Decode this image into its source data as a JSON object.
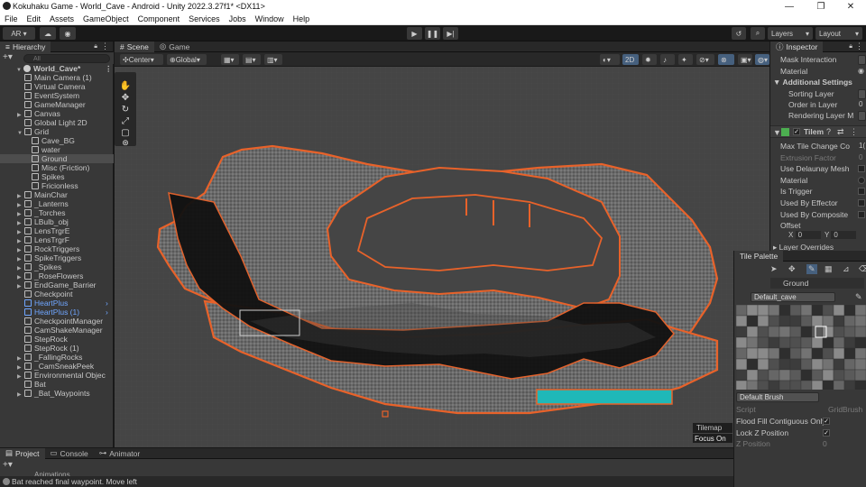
{
  "window": {
    "title": "Kokuhaku Game - World_Cave - Android - Unity 2022.3.27f1* <DX11>",
    "controls": [
      "—",
      "❐",
      "✕"
    ]
  },
  "menu": [
    "File",
    "Edit",
    "Assets",
    "GameObject",
    "Component",
    "Services",
    "Jobs",
    "Window",
    "Help"
  ],
  "toolbar": {
    "account": "AR ▾",
    "layers": "Layers",
    "layout": "Layout"
  },
  "hierarchy": {
    "tab": "Hierarchy",
    "search_placeholder": "All",
    "scene": "World_Cave*",
    "items": [
      {
        "label": "Main Camera (1)",
        "indent": 1
      },
      {
        "label": "Virtual Camera",
        "indent": 1
      },
      {
        "label": "EventSystem",
        "indent": 1
      },
      {
        "label": "GameManager",
        "indent": 1
      },
      {
        "label": "Canvas",
        "indent": 1,
        "arrow": true
      },
      {
        "label": "Global Light 2D",
        "indent": 1
      },
      {
        "label": "Grid",
        "indent": 1,
        "arrow": true,
        "open": true
      },
      {
        "label": "Cave_BG",
        "indent": 2
      },
      {
        "label": "water",
        "indent": 2
      },
      {
        "label": "Ground",
        "indent": 2,
        "selected": true
      },
      {
        "label": "Misc (Friction)",
        "indent": 2
      },
      {
        "label": "Spikes",
        "indent": 2
      },
      {
        "label": "Fricionless",
        "indent": 2
      },
      {
        "label": "MainChar",
        "indent": 1,
        "arrow": true
      },
      {
        "label": "_Lanterns",
        "indent": 1,
        "arrow": true
      },
      {
        "label": "_Torches",
        "indent": 1,
        "arrow": true
      },
      {
        "label": "LBulb_obj",
        "indent": 1,
        "arrow": true
      },
      {
        "label": "LensTrgrE",
        "indent": 1,
        "arrow": true
      },
      {
        "label": "LensTrgrF",
        "indent": 1,
        "arrow": true
      },
      {
        "label": "RockTriggers",
        "indent": 1,
        "arrow": true
      },
      {
        "label": "SpikeTriggers",
        "indent": 1,
        "arrow": true
      },
      {
        "label": "_Spikes",
        "indent": 1,
        "arrow": true
      },
      {
        "label": "_RoseFlowers",
        "indent": 1,
        "arrow": true
      },
      {
        "label": "EndGame_Barrier",
        "indent": 1,
        "arrow": true
      },
      {
        "label": "Checkpoint",
        "indent": 1
      },
      {
        "label": "HeartPlus",
        "indent": 1,
        "blue": true
      },
      {
        "label": "HeartPlus (1)",
        "indent": 1,
        "blue": true
      },
      {
        "label": "CheckpointManager",
        "indent": 1
      },
      {
        "label": "CamShakeManager",
        "indent": 1
      },
      {
        "label": "StepRock",
        "indent": 1
      },
      {
        "label": "StepRock (1)",
        "indent": 1
      },
      {
        "label": "_FallingRocks",
        "indent": 1,
        "arrow": true
      },
      {
        "label": "_CamSneakPeek",
        "indent": 1,
        "arrow": true
      },
      {
        "label": "Environmental Objec",
        "indent": 1,
        "arrow": true
      },
      {
        "label": "Bat",
        "indent": 1
      },
      {
        "label": "_Bat_Waypoints",
        "indent": 1,
        "arrow": true
      }
    ]
  },
  "scene_view": {
    "tabs": [
      "Scene",
      "Game"
    ],
    "pivot": "Center",
    "space": "Global",
    "mode_2d": "2D",
    "overlay_label": "Tilemap",
    "focus_on": "Focus On"
  },
  "inspector": {
    "tab": "Inspector",
    "rows": [
      {
        "label": "Mask Interaction"
      },
      {
        "label": "Material"
      }
    ],
    "section_additional": "Additional Settings",
    "additional_rows": [
      {
        "label": "Sorting Layer"
      },
      {
        "label": "Order in Layer",
        "value": "0"
      },
      {
        "label": "Rendering Layer M"
      }
    ],
    "collider_header": "Tilem",
    "collider_rows": [
      {
        "label": "Max Tile Change Co",
        "value": "1("
      },
      {
        "label": "Extrusion Factor",
        "value": "0",
        "dim": true
      },
      {
        "label": "Use Delaunay Mesh"
      },
      {
        "label": "Material"
      },
      {
        "label": "Is Trigger"
      },
      {
        "label": "Used By Effector"
      },
      {
        "label": "Used By Composite"
      },
      {
        "label": "Offset"
      }
    ],
    "offset_x": "0",
    "offset_y": "0",
    "layer_overrides": "Layer Overrides"
  },
  "tile_palette": {
    "title": "Tile Palette",
    "active_tilemap": "Ground",
    "palette": "Default_cave",
    "brush": "Default Brush",
    "script_label": "Script",
    "script_value": "GridBrush",
    "flood_fill": "Flood Fill Contiguous Only",
    "lock_z": "Lock Z Position",
    "z_position_label": "Z Position",
    "z_position_value": "0"
  },
  "bottom": {
    "tabs": [
      "Project",
      "Console",
      "Animator"
    ],
    "partial_row": "Animations"
  },
  "status": {
    "message": "Bat reached final waypoint. Move left"
  },
  "colors": {
    "outline": "#e8622a",
    "water": "#1fb8b8",
    "rock": "#6b6b6b",
    "tunnel": "#0e0e0e",
    "selection_blue": "#6fa6ff"
  }
}
